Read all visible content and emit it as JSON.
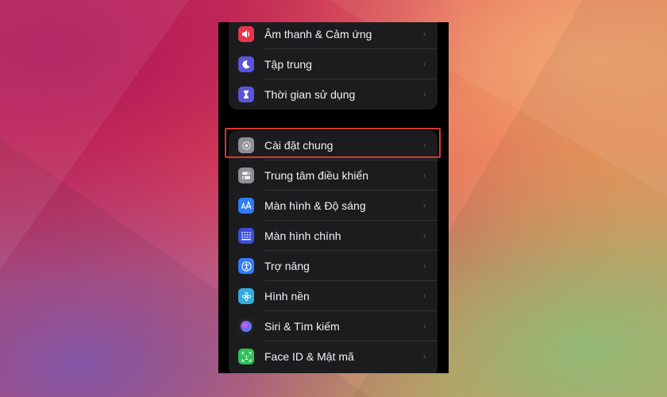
{
  "settings_groups": [
    {
      "rows": [
        {
          "label": "Âm thanh & Cảm ứng",
          "icon": "speaker-icon",
          "color": "#e8354a"
        },
        {
          "label": "Tập trung",
          "icon": "moon-icon",
          "color": "#5a55d6"
        },
        {
          "label": "Thời gian sử dụng",
          "icon": "hourglass-icon",
          "color": "#5a55d6"
        }
      ]
    },
    {
      "rows": [
        {
          "label": "Cài đặt chung",
          "icon": "gear-icon",
          "color": "#8e8e93"
        },
        {
          "label": "Trung tâm điều khiển",
          "icon": "toggle-icon",
          "color": "#8e8e93"
        },
        {
          "label": "Màn hình & Độ sáng",
          "icon": "text-size-icon",
          "color": "#2f7cf6"
        },
        {
          "label": "Màn hình chính",
          "icon": "home-grid-icon",
          "color": "#3b4ed8"
        },
        {
          "label": "Trợ năng",
          "icon": "accessibility-icon",
          "color": "#2f7cf6"
        },
        {
          "label": "Hình nền",
          "icon": "flower-icon",
          "color": "#34aadc"
        },
        {
          "label": "Siri & Tìm kiếm",
          "icon": "siri-icon",
          "color": "#222226"
        },
        {
          "label": "Face ID & Mật mã",
          "icon": "face-id-icon",
          "color": "#30c05a"
        }
      ]
    }
  ],
  "highlighted_row": "Cài đặt chung",
  "highlight_color": "#d6382f",
  "chevron": "›"
}
